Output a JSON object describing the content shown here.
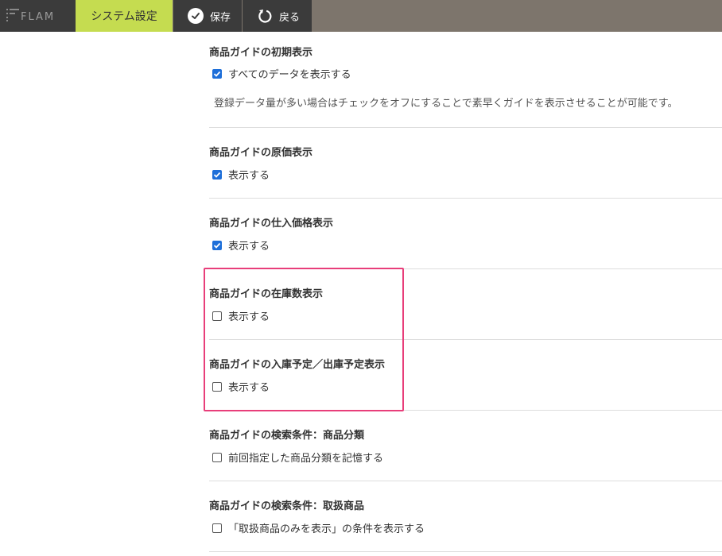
{
  "header": {
    "logo_text": "FLAM",
    "active_tab": "システム設定",
    "save_label": "保存",
    "back_label": "戻る"
  },
  "sections": [
    {
      "title": "商品ガイドの初期表示",
      "checkbox_label": "すべてのデータを表示する",
      "checked": true,
      "note": "登録データ量が多い場合はチェックをオフにすることで素早くガイドを表示させることが可能です。"
    },
    {
      "title": "商品ガイドの原価表示",
      "checkbox_label": "表示する",
      "checked": true
    },
    {
      "title": "商品ガイドの仕入価格表示",
      "checkbox_label": "表示する",
      "checked": true
    },
    {
      "title": "商品ガイドの在庫数表示",
      "checkbox_label": "表示する",
      "checked": false
    },
    {
      "title": "商品ガイドの入庫予定／出庫予定表示",
      "checkbox_label": "表示する",
      "checked": false
    },
    {
      "title": "商品ガイドの検索条件：商品分類",
      "checkbox_label": "前回指定した商品分類を記憶する",
      "checked": false
    },
    {
      "title": "商品ガイドの検索条件：取扱商品",
      "checkbox_label": "「取扱商品のみを表示」の条件を表示する",
      "checked": false
    }
  ],
  "colors": {
    "accent_tab": "#c5dc50",
    "highlight_border": "#e83e7a",
    "checkbox_checked": "#1e6fd9"
  }
}
